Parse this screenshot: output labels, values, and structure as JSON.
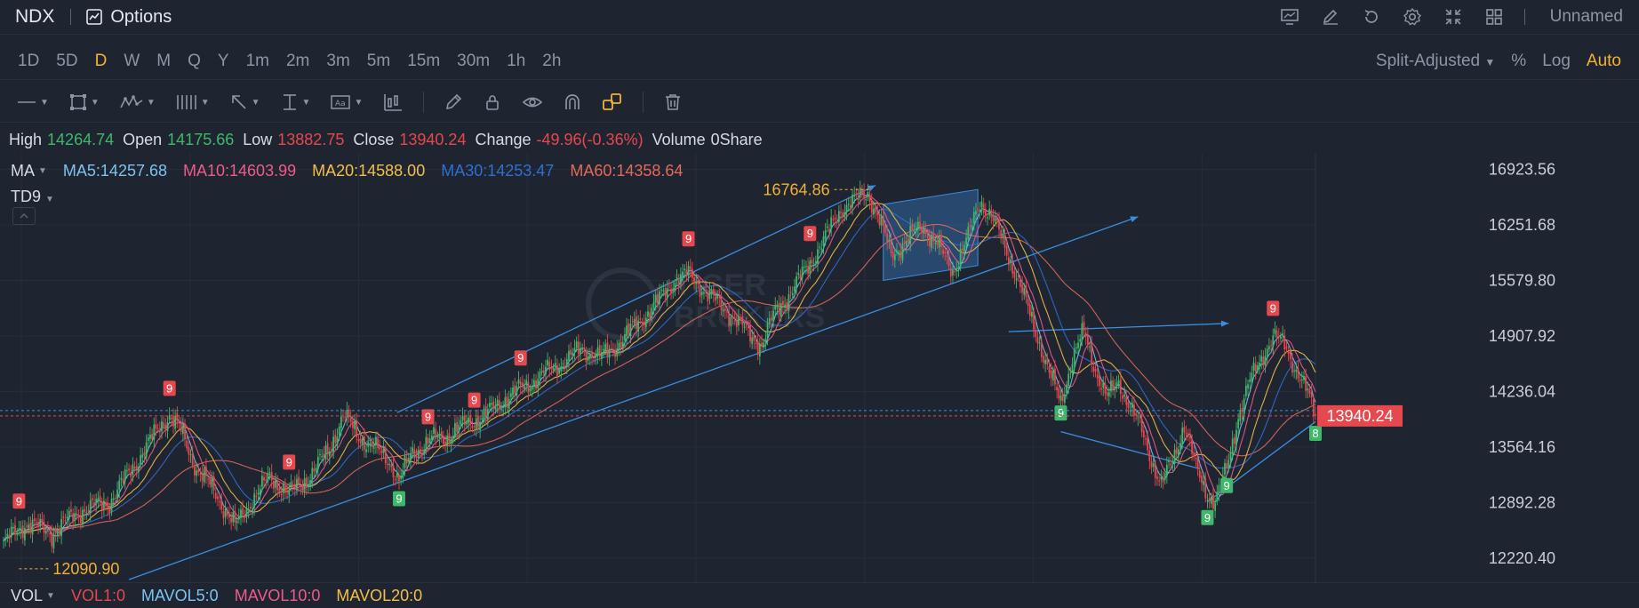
{
  "header": {
    "symbol": "NDX",
    "options_label": "Options",
    "layout_name": "Unnamed"
  },
  "timeframes": [
    "1D",
    "5D",
    "D",
    "W",
    "M",
    "Q",
    "Y",
    "1m",
    "2m",
    "3m",
    "5m",
    "15m",
    "30m",
    "1h",
    "2h"
  ],
  "active_timeframe": "D",
  "scale_options": {
    "adjust": "Split-Adjusted",
    "percent": "%",
    "log": "Log",
    "auto": "Auto"
  },
  "ohlc": {
    "high_label": "High",
    "high": "14264.74",
    "open_label": "Open",
    "open": "14175.66",
    "low_label": "Low",
    "low": "13882.75",
    "close_label": "Close",
    "close": "13940.24",
    "change_label": "Change",
    "change": "-49.96(-0.36%)",
    "volume_label": "Volume",
    "volume": "0Share"
  },
  "indicators": {
    "ma_label": "MA",
    "ma5": "MA5:14257.68",
    "ma10": "MA10:14603.99",
    "ma20": "MA20:14588.00",
    "ma30": "MA30:14253.47",
    "ma60": "MA60:14358.64",
    "td9_label": "TD9"
  },
  "volume_bar": {
    "label": "VOL",
    "vol1": "VOL1:0",
    "mavol5": "MAVOL5:0",
    "mavol10": "MAVOL10:0",
    "mavol20": "MAVOL20:0"
  },
  "watermark": {
    "line1": "TIGER",
    "line2": "BROKERS"
  },
  "colors": {
    "up": "#3fb86a",
    "down": "#e5484d",
    "accent": "#f2b233",
    "ma5": "#7ec3f0",
    "ma10": "#ef5b8a",
    "ma20": "#f2c04a",
    "ma30": "#2f6fd1",
    "ma60": "#e36a5a",
    "trend": "#3b8ee0"
  },
  "chart_data": {
    "type": "candlestick",
    "symbol": "NDX",
    "y_ticks": [
      16923.56,
      16251.68,
      15579.8,
      14907.92,
      14236.04,
      13564.16,
      12892.28,
      12220.4
    ],
    "ylim": [
      11960,
      17080
    ],
    "last_price": 13940.24,
    "annotations": {
      "high_label": "16764.86",
      "low_label": "12090.90"
    },
    "close_path": [
      [
        0,
        12400
      ],
      [
        12,
        12650
      ],
      [
        25,
        12520
      ],
      [
        40,
        12800
      ],
      [
        55,
        12900
      ],
      [
        65,
        13250
      ],
      [
        75,
        13600
      ],
      [
        82,
        13850
      ],
      [
        86,
        13950
      ],
      [
        92,
        13750
      ],
      [
        100,
        13300
      ],
      [
        110,
        13000
      ],
      [
        120,
        12600
      ],
      [
        128,
        12900
      ],
      [
        138,
        13200
      ],
      [
        148,
        13000
      ],
      [
        158,
        13200
      ],
      [
        168,
        13500
      ],
      [
        176,
        13950
      ],
      [
        184,
        13700
      ],
      [
        192,
        13550
      ],
      [
        200,
        13400
      ],
      [
        205,
        13150
      ],
      [
        212,
        13500
      ],
      [
        222,
        13650
      ],
      [
        230,
        13700
      ],
      [
        240,
        13850
      ],
      [
        250,
        13950
      ],
      [
        260,
        14150
      ],
      [
        270,
        14300
      ],
      [
        280,
        14450
      ],
      [
        290,
        14600
      ],
      [
        300,
        14750
      ],
      [
        310,
        14650
      ],
      [
        320,
        14850
      ],
      [
        330,
        15100
      ],
      [
        340,
        15350
      ],
      [
        348,
        15600
      ],
      [
        355,
        15650
      ],
      [
        362,
        15500
      ],
      [
        370,
        15300
      ],
      [
        378,
        15150
      ],
      [
        385,
        14950
      ],
      [
        393,
        14800
      ],
      [
        400,
        15200
      ],
      [
        410,
        15500
      ],
      [
        418,
        15800
      ],
      [
        426,
        16100
      ],
      [
        434,
        16450
      ],
      [
        442,
        16550
      ],
      [
        448,
        16650
      ],
      [
        454,
        16300
      ],
      [
        460,
        15900
      ],
      [
        468,
        16050
      ],
      [
        476,
        16250
      ],
      [
        484,
        16000
      ],
      [
        492,
        15700
      ],
      [
        500,
        16100
      ],
      [
        506,
        16550
      ],
      [
        512,
        16350
      ],
      [
        518,
        16050
      ],
      [
        524,
        15700
      ],
      [
        530,
        15300
      ],
      [
        536,
        14900
      ],
      [
        542,
        14450
      ],
      [
        548,
        14100
      ],
      [
        554,
        14650
      ],
      [
        560,
        14950
      ],
      [
        566,
        14500
      ],
      [
        572,
        14150
      ],
      [
        578,
        14350
      ],
      [
        584,
        14050
      ],
      [
        590,
        13750
      ],
      [
        596,
        13350
      ],
      [
        600,
        13100
      ],
      [
        606,
        13400
      ],
      [
        612,
        13850
      ],
      [
        618,
        13300
      ],
      [
        624,
        13000
      ],
      [
        628,
        12900
      ],
      [
        634,
        13300
      ],
      [
        640,
        13950
      ],
      [
        646,
        14350
      ],
      [
        652,
        14650
      ],
      [
        658,
        14900
      ],
      [
        664,
        14800
      ],
      [
        670,
        14500
      ],
      [
        676,
        14200
      ],
      [
        680,
        13940
      ]
    ],
    "moving_averages": {
      "MA5": 14257.68,
      "MA10": 14603.99,
      "MA20": 14588.0,
      "MA30": 14253.47,
      "MA60": 14358.64
    },
    "td9_markers": [
      {
        "i": 8,
        "label": "9",
        "color": "red"
      },
      {
        "i": 86,
        "label": "9",
        "color": "red"
      },
      {
        "i": 148,
        "label": "9",
        "color": "red"
      },
      {
        "i": 205,
        "label": "9",
        "color": "green"
      },
      {
        "i": 220,
        "label": "9",
        "color": "red"
      },
      {
        "i": 244,
        "label": "9",
        "color": "red"
      },
      {
        "i": 268,
        "label": "9",
        "color": "red"
      },
      {
        "i": 355,
        "label": "9",
        "color": "red"
      },
      {
        "i": 418,
        "label": "9",
        "color": "red"
      },
      {
        "i": 548,
        "label": "9",
        "color": "green"
      },
      {
        "i": 624,
        "label": "9",
        "color": "green"
      },
      {
        "i": 634,
        "label": "9",
        "color": "green"
      },
      {
        "i": 658,
        "label": "9",
        "color": "red"
      },
      {
        "i": 680,
        "label": "8",
        "color": "green"
      }
    ],
    "volume": {
      "VOL1": 0,
      "MAVOL5": 0,
      "MAVOL10": 0,
      "MAVOL20": 0
    }
  }
}
